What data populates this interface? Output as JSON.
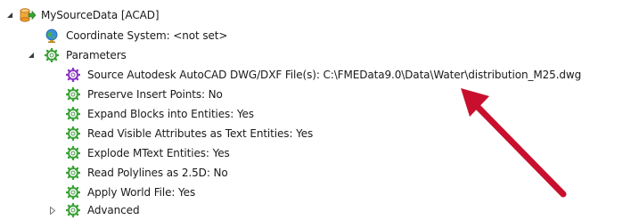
{
  "tree": {
    "root": {
      "label": "MySourceData [ACAD]",
      "expanded": true
    },
    "coordinate_system": {
      "label": "Coordinate System: <not set>"
    },
    "parameters": {
      "label": "Parameters",
      "expanded": true,
      "items": [
        {
          "label": "Source Autodesk AutoCAD DWG/DXF File(s): C:\\FMEData9.0\\Data\\Water\\distribution_M25.dwg"
        },
        {
          "label": "Preserve Insert Points: No"
        },
        {
          "label": "Expand Blocks into Entities: Yes"
        },
        {
          "label": "Read Visible Attributes as Text Entities: Yes"
        },
        {
          "label": "Explode MText Entities: Yes"
        },
        {
          "label": "Read Polylines as 2.5D: No"
        },
        {
          "label": "Apply World File: Yes"
        }
      ]
    },
    "advanced": {
      "label": "Advanced",
      "expanded": false
    }
  },
  "colors": {
    "annotation_arrow": "#c8102e",
    "gear_icon": "#8a35c6",
    "gear_icon_params": "#3aa336"
  }
}
